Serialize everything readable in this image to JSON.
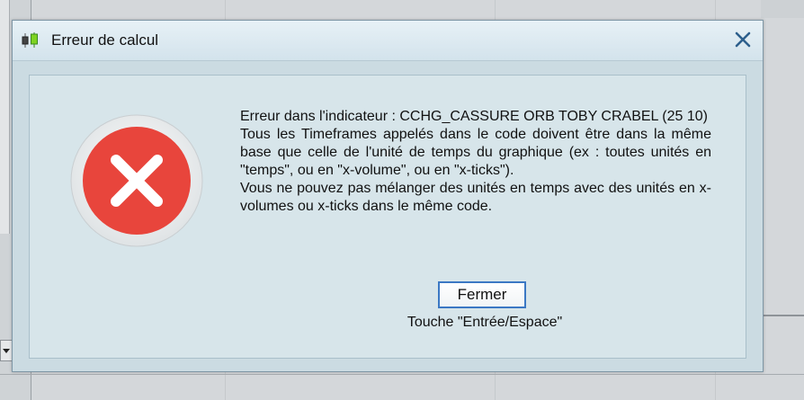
{
  "dialog": {
    "title": "Erreur de calcul",
    "app_icon": "candlestick-chart-icon",
    "close_icon": "close-icon",
    "error_icon": "error-x-icon",
    "message": {
      "line1": "Erreur dans l'indicateur : CCHG_CASSURE ORB TOBY CRABEL (25 10)",
      "line2": "Tous les Timeframes appelés dans le code doivent être dans la même base que celle de l'unité de temps du graphique (ex : toutes unités en \"temps\", ou en \"x-volume\", ou en \"x-ticks\").",
      "line3": "Vous ne pouvez pas mélanger des unités en temps avec des unités en x-volumes ou x-ticks dans le même code."
    },
    "ok_button_label": "Fermer",
    "keyboard_hint": "Touche \"Entrée/Espace\""
  },
  "colors": {
    "dialog_background": "#cbdbe2",
    "error_red": "#e8453c",
    "focus_border": "#3b78c4",
    "close_icon": "#2d5f8c"
  }
}
